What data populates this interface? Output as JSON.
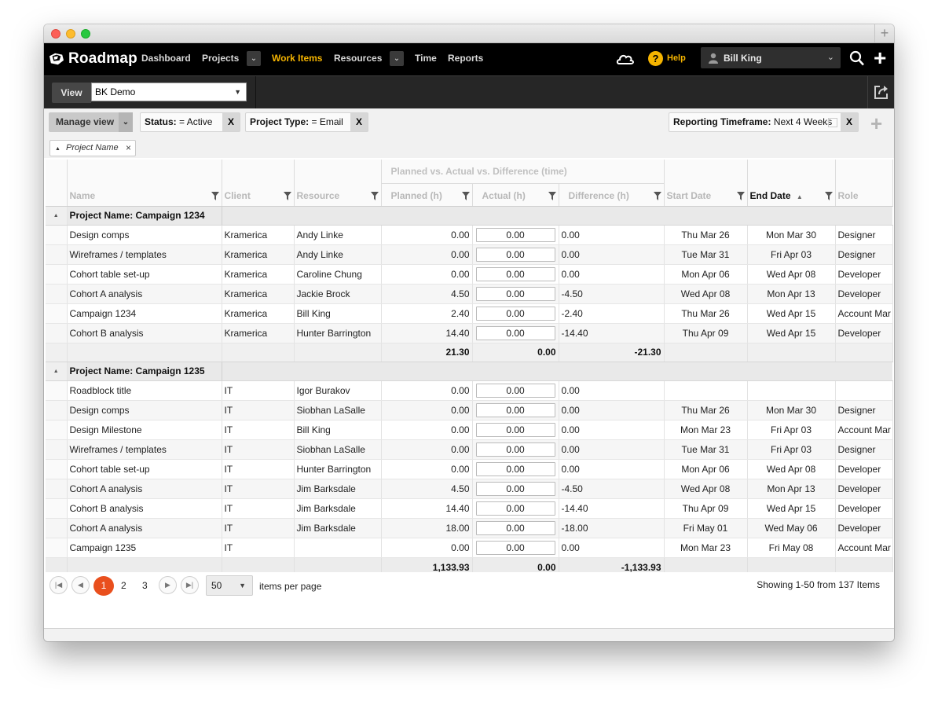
{
  "window": {
    "new_tab_symbol": "+"
  },
  "nav": {
    "brand": "Roadmap",
    "items": [
      "Dashboard",
      "Projects",
      "Work Items",
      "Resources",
      "Time",
      "Reports"
    ],
    "active": "Work Items",
    "help_label": "Help",
    "help_symbol": "?",
    "user_name": "Bill King",
    "plus_symbol": "+",
    "accent_color": "#f5b400"
  },
  "viewbar": {
    "label": "View",
    "selected_view": "BK Demo"
  },
  "filters": {
    "manage_view_label": "Manage view",
    "chips": [
      {
        "key": "Status:",
        "value": "= Active",
        "remove": "X"
      },
      {
        "key": "Project Type:",
        "value": "= Email",
        "remove": "X"
      }
    ],
    "timeframe": {
      "key": "Reporting Timeframe:",
      "value": "Next 4 Weeks",
      "remove": "X"
    },
    "add_symbol": "+",
    "group_by_chip": "Project Name",
    "group_by_remove": "×"
  },
  "grid": {
    "group_header": "Planned vs. Actual vs. Difference (time)",
    "columns": {
      "name": "Name",
      "client": "Client",
      "resource": "Resource",
      "planned": "Planned (h)",
      "actual": "Actual (h)",
      "difference": "Difference (h)",
      "start": "Start Date",
      "end": "End Date",
      "role": "Role"
    },
    "groups": [
      {
        "title": "Project Name: Campaign 1234",
        "rows": [
          {
            "name": "Design comps",
            "client": "Kramerica",
            "resource": "Andy Linke",
            "planned": "0.00",
            "actual": "0.00",
            "difference": "0.00",
            "start": "Thu Mar 26",
            "end": "Mon Mar 30",
            "end_overdue": true,
            "role": "Designer"
          },
          {
            "name": "Wireframes / templates",
            "client": "Kramerica",
            "resource": "Andy Linke",
            "planned": "0.00",
            "actual": "0.00",
            "difference": "0.00",
            "start": "Tue Mar 31",
            "end": "Fri Apr 03",
            "end_overdue": true,
            "role": "Designer"
          },
          {
            "name": "Cohort table set-up",
            "client": "Kramerica",
            "resource": "Caroline Chung",
            "planned": "0.00",
            "actual": "0.00",
            "difference": "0.00",
            "start": "Mon Apr 06",
            "end": "Wed Apr 08",
            "end_overdue": true,
            "role": "Developer"
          },
          {
            "name": "Cohort A analysis",
            "client": "Kramerica",
            "resource": "Jackie Brock",
            "planned": "4.50",
            "actual": "0.00",
            "difference": "-4.50",
            "start": "Wed Apr 08",
            "end": "Mon Apr 13",
            "end_overdue": false,
            "role": "Developer"
          },
          {
            "name": "Campaign 1234",
            "client": "Kramerica",
            "resource": "Bill King",
            "planned": "2.40",
            "actual": "0.00",
            "difference": "-2.40",
            "start": "Thu Mar 26",
            "end": "Wed Apr 15",
            "end_overdue": false,
            "role": "Account Mar"
          },
          {
            "name": "Cohort B analysis",
            "client": "Kramerica",
            "resource": "Hunter Barrington",
            "planned": "14.40",
            "actual": "0.00",
            "difference": "-14.40",
            "start": "Thu Apr 09",
            "end": "Wed Apr 15",
            "end_overdue": false,
            "role": "Developer"
          }
        ],
        "subtotal": {
          "planned": "21.30",
          "actual": "0.00",
          "difference": "-21.30"
        }
      },
      {
        "title": "Project Name: Campaign 1235",
        "rows": [
          {
            "name": "Roadblock title",
            "client": "IT",
            "resource": "Igor Burakov",
            "planned": "0.00",
            "actual": "0.00",
            "difference": "0.00",
            "start": "",
            "end": "",
            "end_overdue": false,
            "role": ""
          },
          {
            "name": "Design comps",
            "client": "IT",
            "resource": "Siobhan LaSalle",
            "planned": "0.00",
            "actual": "0.00",
            "difference": "0.00",
            "start": "Thu Mar 26",
            "end": "Mon Mar 30",
            "end_overdue": true,
            "role": "Designer"
          },
          {
            "name": "Design Milestone",
            "client": "IT",
            "resource": "Bill King",
            "planned": "0.00",
            "actual": "0.00",
            "difference": "0.00",
            "start": "Mon Mar 23",
            "end": "Fri Apr 03",
            "end_overdue": true,
            "role": "Account Mar"
          },
          {
            "name": "Wireframes / templates",
            "client": "IT",
            "resource": "Siobhan LaSalle",
            "planned": "0.00",
            "actual": "0.00",
            "difference": "0.00",
            "start": "Tue Mar 31",
            "end": "Fri Apr 03",
            "end_overdue": true,
            "role": "Designer"
          },
          {
            "name": "Cohort table set-up",
            "client": "IT",
            "resource": "Hunter Barrington",
            "planned": "0.00",
            "actual": "0.00",
            "difference": "0.00",
            "start": "Mon Apr 06",
            "end": "Wed Apr 08",
            "end_overdue": true,
            "role": "Developer"
          },
          {
            "name": "Cohort A analysis",
            "client": "IT",
            "resource": "Jim Barksdale",
            "planned": "4.50",
            "actual": "0.00",
            "difference": "-4.50",
            "start": "Wed Apr 08",
            "end": "Mon Apr 13",
            "end_overdue": false,
            "role": "Developer"
          },
          {
            "name": "Cohort B analysis",
            "client": "IT",
            "resource": "Jim Barksdale",
            "planned": "14.40",
            "actual": "0.00",
            "difference": "-14.40",
            "start": "Thu Apr 09",
            "end": "Wed Apr 15",
            "end_overdue": false,
            "role": "Developer"
          },
          {
            "name": "Cohort A analysis",
            "client": "IT",
            "resource": "Jim Barksdale",
            "planned": "18.00",
            "actual": "0.00",
            "difference": "-18.00",
            "start": "Fri May 01",
            "end": "Wed May 06",
            "end_overdue": false,
            "role": "Developer"
          },
          {
            "name": "Campaign 1235",
            "client": "IT",
            "resource": "",
            "planned": "0.00",
            "actual": "0.00",
            "difference": "0.00",
            "start": "Mon Mar 23",
            "end": "Fri May 08",
            "end_overdue": false,
            "role": "Account Mar"
          }
        ]
      }
    ],
    "grand_total": {
      "planned": "1,133.93",
      "actual": "0.00",
      "difference": "-1,133.93"
    },
    "overdue_color": "#cc2222"
  },
  "pager": {
    "current_page": "1",
    "pages": [
      "2",
      "3"
    ],
    "per_page": "50",
    "per_page_label": "items per page",
    "showing": "Showing 1-50 from 137 Items"
  }
}
